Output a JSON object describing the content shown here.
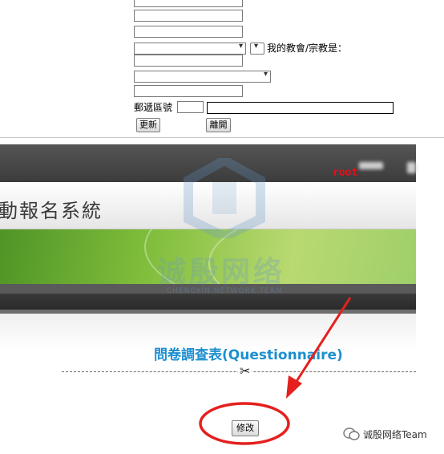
{
  "form": {
    "church_label": "我的教會/宗教是：",
    "postal_label": "郵遞區號",
    "update_button": "更新",
    "leave_button": "離開"
  },
  "banner": {
    "user": "root",
    "system_title": "動報名系統",
    "questionnaire_title": "問卷調查表(Questionnaire)",
    "modify_button": "修改"
  },
  "watermark": {
    "text": "诚殷网络",
    "sub": "CHENGYIN NETWORK TEAM"
  },
  "footer": {
    "account": "诚殷网络Team"
  },
  "colors": {
    "annotation_red": "#e5201e",
    "questionnaire_blue": "#1c8fd0",
    "root_red": "#e0101a"
  }
}
